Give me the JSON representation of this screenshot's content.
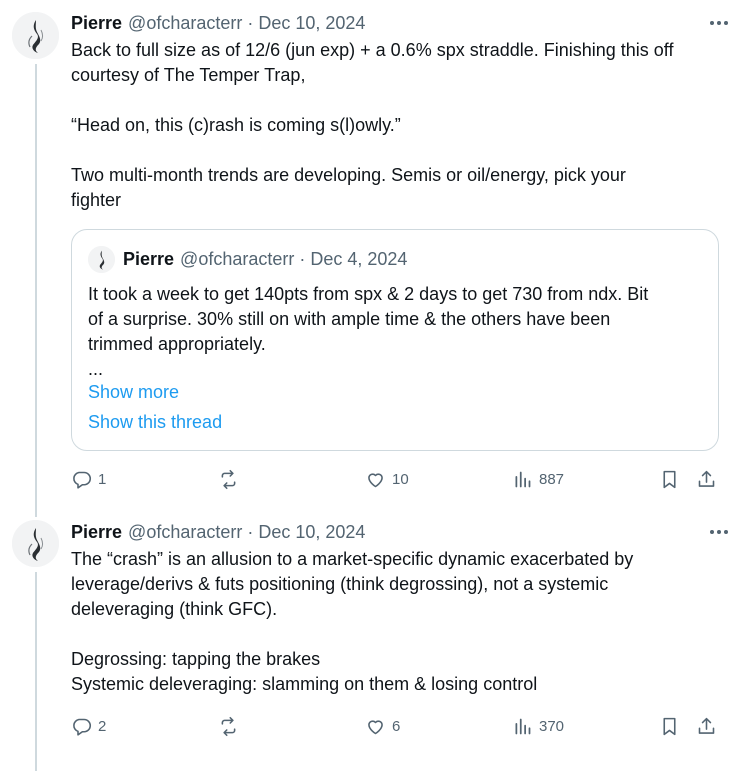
{
  "tweets": [
    {
      "name": "Pierre",
      "handle": "@ofcharacterr",
      "separator": "·",
      "date": "Dec 10, 2024",
      "text": "Back to full size as of 12/6 (jun exp) + a 0.6% spx straddle. Finishing this off\ncourtesy of The Temper Trap,\n\n“Head on, this (c)rash is coming s(l)owly.”\n\nTwo multi-month trends are developing. Semis or oil/energy, pick your\nfighter",
      "quote": {
        "name": "Pierre",
        "handle": "@ofcharacterr",
        "separator": "·",
        "date": "Dec 4, 2024",
        "text": "It took a week to get 140pts from spx & 2 days to get 730 from ndx. Bit\nof a surprise. 30% still on with ample time & the others have been\ntrimmed appropriately.\n...",
        "show_more": "Show more",
        "show_thread": "Show this thread"
      },
      "stats": {
        "replies": "1",
        "reposts": "",
        "likes": "10",
        "views": "887"
      }
    },
    {
      "name": "Pierre",
      "handle": "@ofcharacterr",
      "separator": "·",
      "date": "Dec 10, 2024",
      "text": "The “crash” is an allusion to a market-specific dynamic exacerbated by\nleverage/derivs & futs positioning (think degrossing), not a systemic\ndeleveraging (think GFC).\n\nDegrossing: tapping the brakes\nSystemic deleveraging: slamming on them & losing control",
      "stats": {
        "replies": "2",
        "reposts": "",
        "likes": "6",
        "views": "370"
      }
    }
  ],
  "icons": {
    "reply": "reply-icon",
    "repost": "repost-icon",
    "like": "heart-icon",
    "views": "views-chart-icon",
    "bookmark": "bookmark-icon",
    "share": "share-icon",
    "more": "more-icon"
  },
  "colors": {
    "link": "#1d9bf0",
    "muted": "#536471",
    "text": "#0f1419",
    "border": "#cfd9de"
  }
}
